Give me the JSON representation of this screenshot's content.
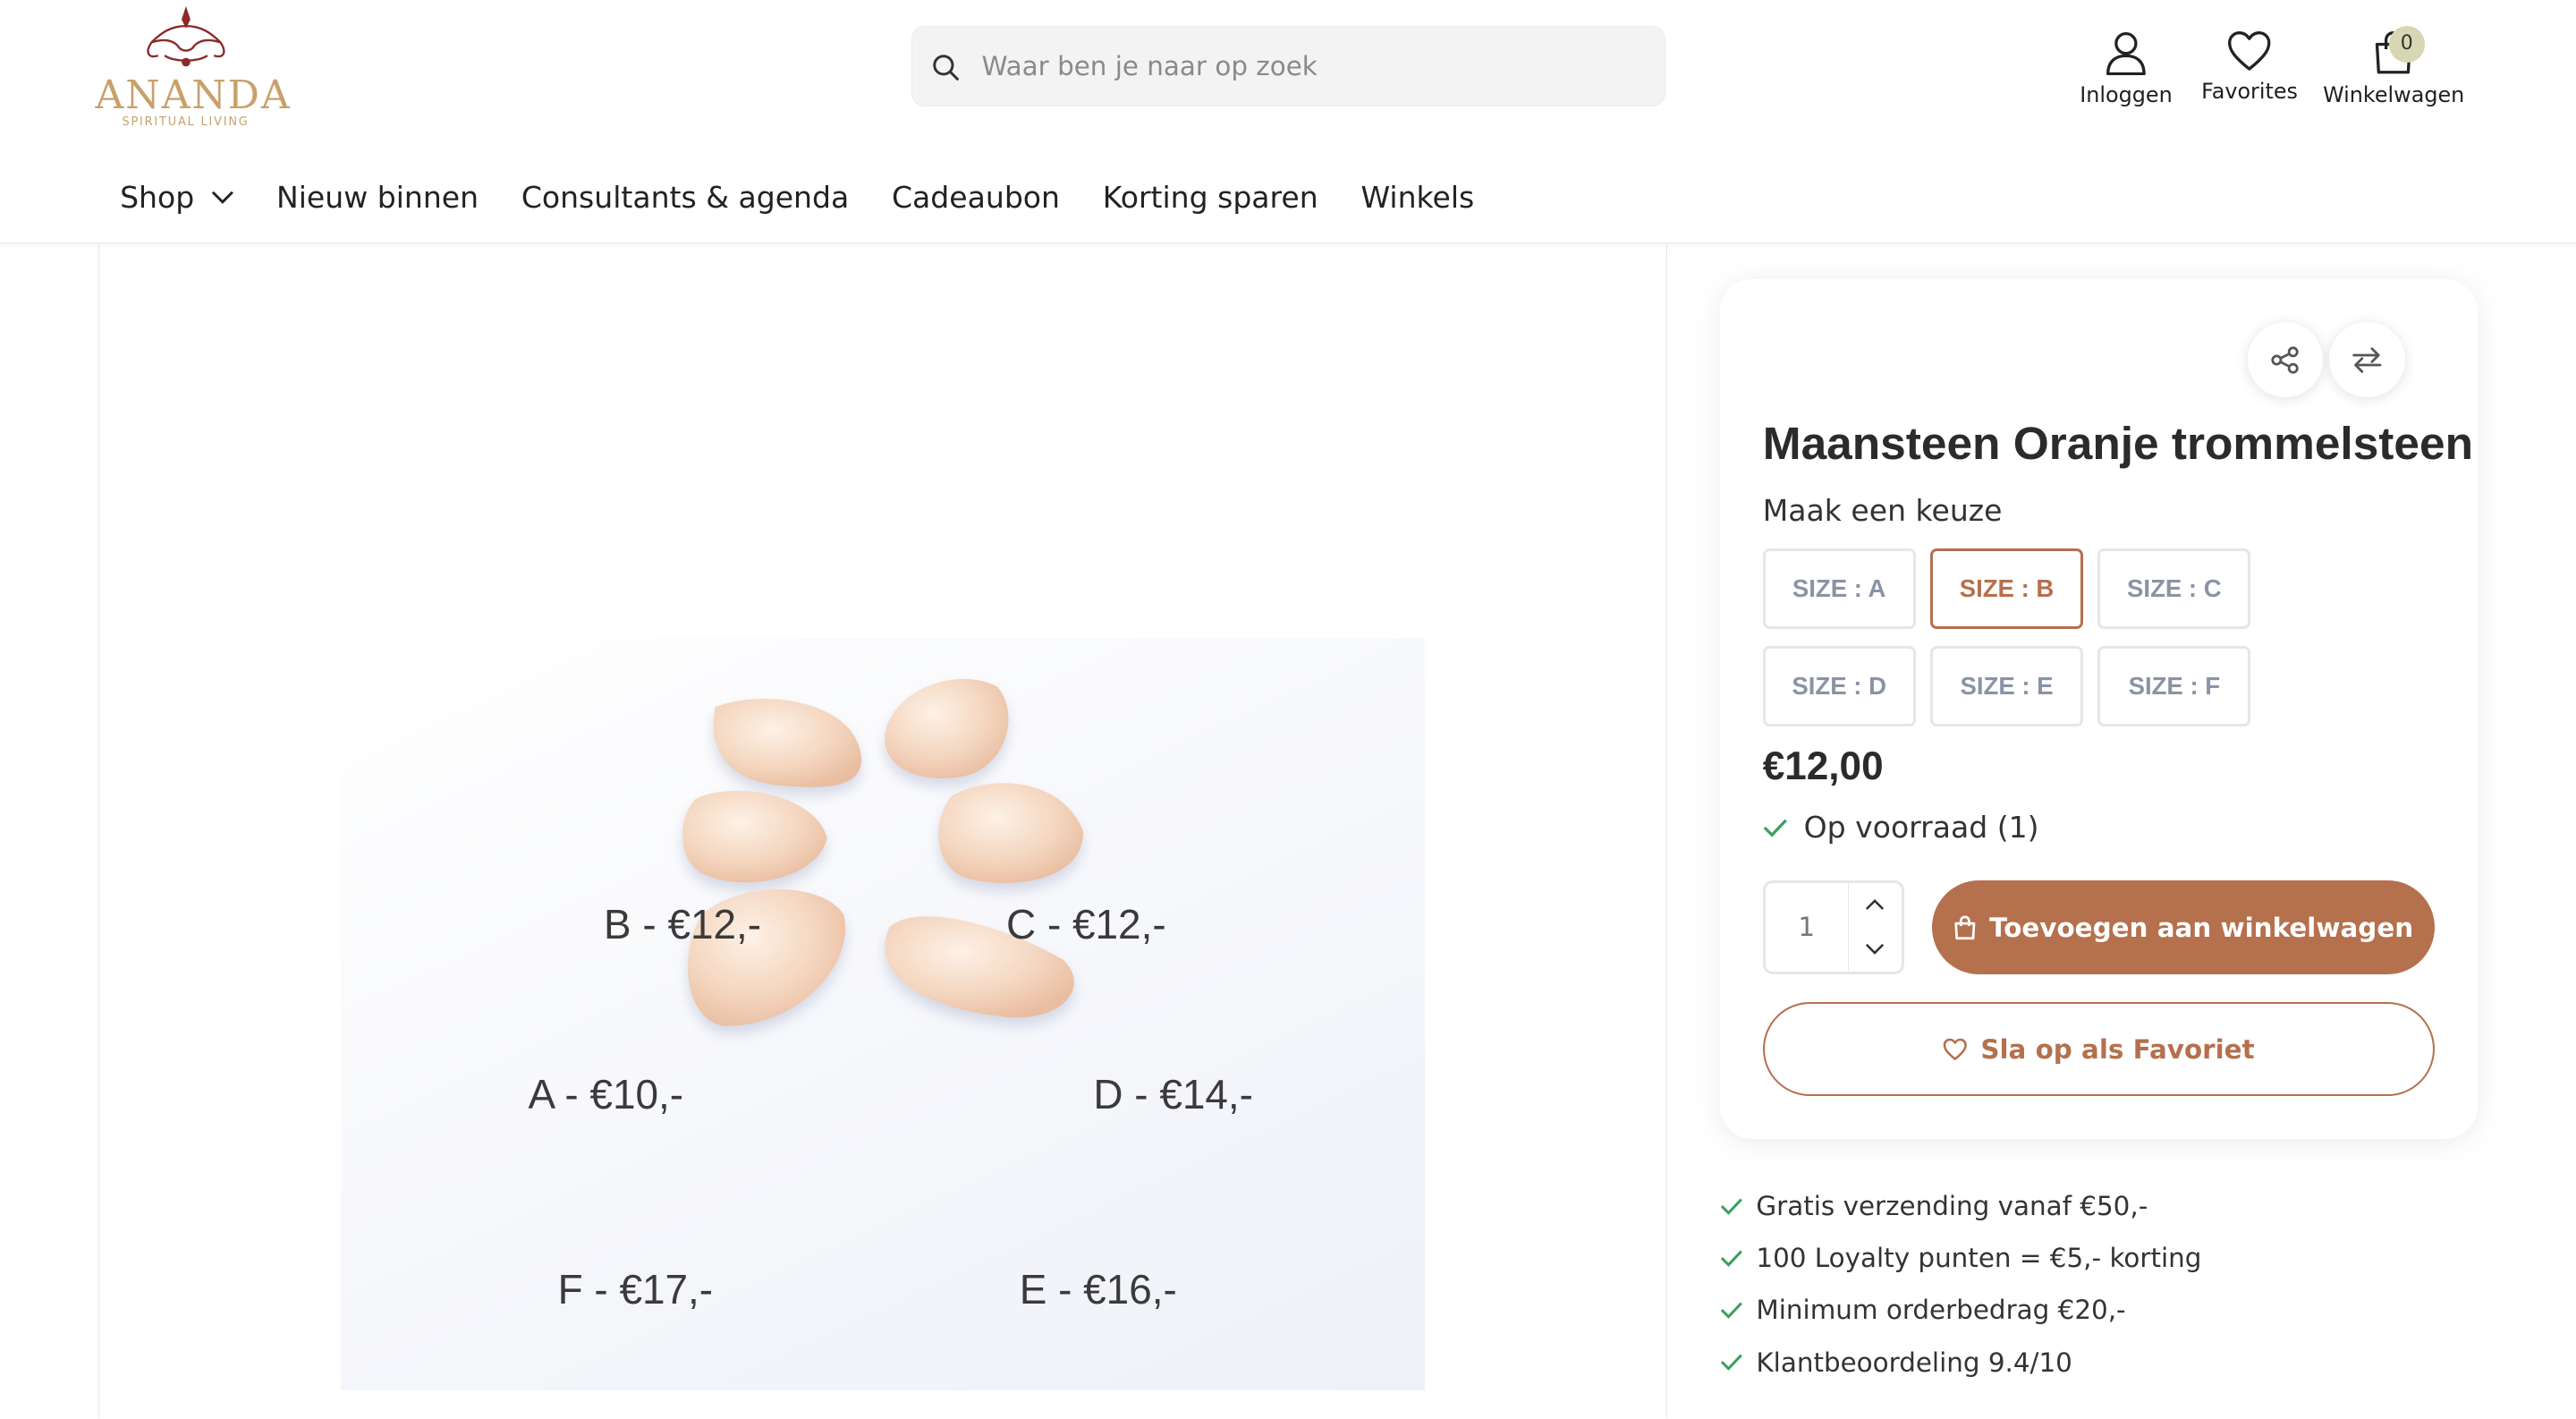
{
  "brand": {
    "name": "ANANDA",
    "tagline": "SPIRITUAL LIVING"
  },
  "search": {
    "placeholder": "Waar ben je naar op zoek"
  },
  "header_actions": [
    {
      "label": "Inloggen",
      "icon": "user-icon"
    },
    {
      "label": "Favorites",
      "icon": "heart-icon"
    },
    {
      "label": "Winkelwagen",
      "icon": "shopping-bag-icon",
      "badge": "0"
    }
  ],
  "nav": [
    {
      "label": "Shop",
      "has_dropdown": true
    },
    {
      "label": "Nieuw binnen"
    },
    {
      "label": "Consultants & agenda"
    },
    {
      "label": "Cadeaubon"
    },
    {
      "label": "Korting sparen"
    },
    {
      "label": "Winkels"
    }
  ],
  "image": {
    "price_labels": [
      "B - €12,-",
      "C - €12,-",
      "A - €10,-",
      "D - €14,-",
      "F - €17,-",
      "E - €16,-"
    ]
  },
  "product": {
    "title": "Maansteen Oranje trommelsteen",
    "choose_label": "Maak een keuze",
    "sizes": [
      "SIZE : A",
      "SIZE : B",
      "SIZE : C",
      "SIZE : D",
      "SIZE : E",
      "SIZE : F"
    ],
    "selected_size": "SIZE : B",
    "price": "€12,00",
    "stock": "Op voorraad (1)",
    "quantity": "1",
    "add_to_cart": "Toevoegen aan winkelwagen",
    "save_favorite": "Sla op als Favoriet"
  },
  "usps": [
    "Gratis verzending vanaf €50,-",
    "100 Loyalty punten = €5,- korting",
    "Minimum orderbedrag €20,-",
    "Klantbeoordeling 9.4/10"
  ],
  "colors": {
    "accent": "#b5704d",
    "check": "#3aa060",
    "logo": "#c9a06b",
    "logo_ornament": "#8c2a2a"
  }
}
